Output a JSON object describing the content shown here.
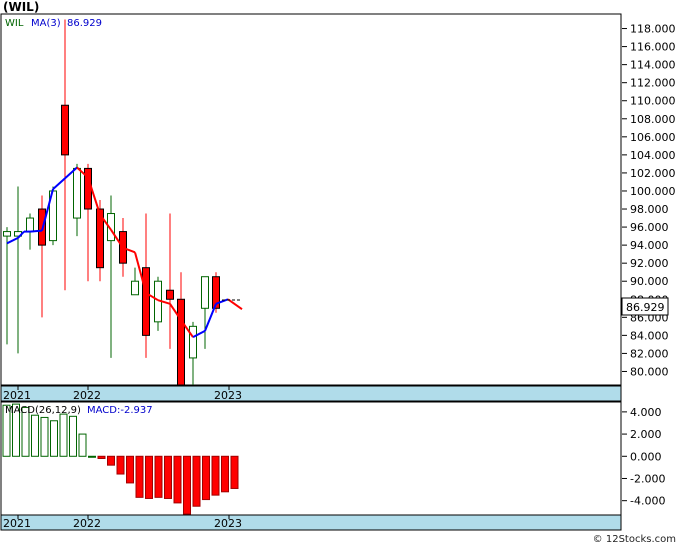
{
  "title": "(WIL)",
  "footer": "© 12Stocks.com",
  "price_panel": {
    "symbol_label": "WIL",
    "ma_label": "MA(3)",
    "ma_value": "86.929",
    "last_price_label": "86.929",
    "yaxis_ticks": [
      "80.000",
      "82.000",
      "84.000",
      "86.000",
      "88.000",
      "90.000",
      "92.000",
      "94.000",
      "96.000",
      "98.000",
      "100.000",
      "102.000",
      "104.000",
      "106.000",
      "108.000",
      "110.000",
      "112.000",
      "114.000",
      "116.000",
      "118.000"
    ],
    "xaxis_labels": [
      "2021",
      "2022",
      "2023"
    ]
  },
  "macd_panel": {
    "label": "MACD(26,12,9)",
    "value_label": "MACD:-2.937",
    "yaxis_ticks": [
      "4.000",
      "2.000",
      "0.000",
      "-2.000",
      "-4.000"
    ],
    "xaxis_labels": [
      "2021",
      "2022",
      "2023"
    ]
  },
  "colors": {
    "up_candle": "#006400",
    "down_candle": "#ff0000",
    "ma_up": "#0000ff",
    "ma_down": "#ff0000",
    "axis_band": "#b0dcea",
    "grid": "#c8c8c8"
  },
  "chart_data": [
    {
      "type": "candlestick",
      "title": "(WIL)",
      "ylim": [
        78.5,
        119.5
      ],
      "candles": [
        {
          "o": 95.0,
          "h": 96.0,
          "l": 83.0,
          "c": 95.5
        },
        {
          "o": 95.0,
          "h": 100.5,
          "l": 82.0,
          "c": 95.5
        },
        {
          "o": 95.5,
          "h": 97.5,
          "l": 93.5,
          "c": 97.0
        },
        {
          "o": 98.0,
          "h": 99.5,
          "l": 86.0,
          "c": 94.0
        },
        {
          "o": 94.5,
          "h": 100.5,
          "l": 94.0,
          "c": 100.0
        },
        {
          "o": 109.5,
          "h": 119.0,
          "l": 89.0,
          "c": 104.0
        },
        {
          "o": 97.0,
          "h": 103.0,
          "l": 95.0,
          "c": 102.5
        },
        {
          "o": 102.5,
          "h": 103.0,
          "l": 90.0,
          "c": 98.0
        },
        {
          "o": 98.0,
          "h": 99.0,
          "l": 90.0,
          "c": 91.5
        },
        {
          "o": 94.5,
          "h": 99.5,
          "l": 81.5,
          "c": 97.5
        },
        {
          "o": 95.5,
          "h": 97.0,
          "l": 90.5,
          "c": 92.0
        },
        {
          "o": 88.5,
          "h": 91.5,
          "l": 88.5,
          "c": 90.0
        },
        {
          "o": 91.5,
          "h": 97.5,
          "l": 81.5,
          "c": 84.0
        },
        {
          "o": 85.5,
          "h": 90.5,
          "l": 84.5,
          "c": 90.0
        },
        {
          "o": 89.0,
          "h": 97.5,
          "l": 82.5,
          "c": 88.0
        },
        {
          "o": 88.0,
          "h": 91.0,
          "l": 78.5,
          "c": 78.5
        },
        {
          "o": 81.5,
          "h": 85.5,
          "l": 78.5,
          "c": 85.0
        },
        {
          "o": 87.0,
          "h": 90.5,
          "l": 82.5,
          "c": 90.5
        },
        {
          "o": 90.5,
          "h": 91.0,
          "l": 86.5,
          "c": 87.0
        }
      ],
      "ma": [
        94.2,
        94.8,
        95.5,
        95.5,
        95.6,
        100.2,
        102.6,
        101.5,
        97.4,
        95.7,
        93.7,
        93.2,
        88.7,
        87.9,
        87.5,
        85.7,
        83.8,
        84.5,
        87.5,
        88.0,
        86.9
      ]
    },
    {
      "type": "bar",
      "title": "MACD(26,12,9)",
      "ylim": [
        -5.2,
        4.8
      ],
      "values": [
        4.6,
        4.7,
        4.4,
        3.7,
        3.5,
        3.2,
        3.8,
        3.6,
        2.0,
        0.0,
        -0.2,
        -0.8,
        -1.6,
        -2.4,
        -3.7,
        -3.8,
        -3.7,
        -3.8,
        -4.2,
        -5.2,
        -4.5,
        -3.9,
        -3.5,
        -3.2,
        -2.9
      ]
    }
  ]
}
